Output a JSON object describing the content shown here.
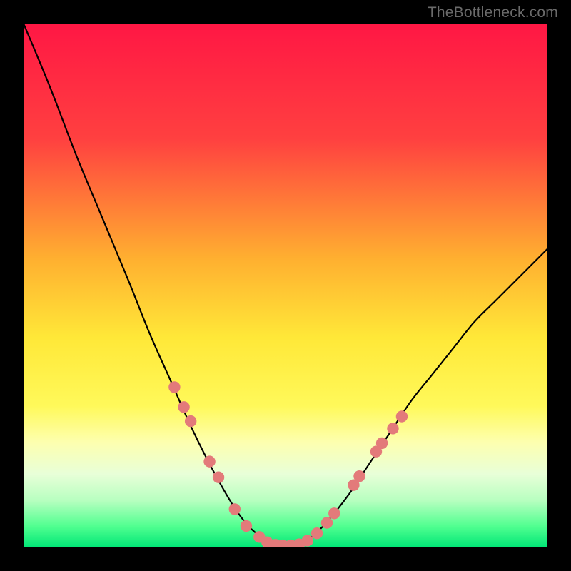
{
  "watermark": "TheBottleneck.com",
  "chart_data": {
    "type": "line",
    "title": "",
    "xlabel": "",
    "ylabel": "",
    "xlim": [
      0,
      100
    ],
    "ylim": [
      0,
      100
    ],
    "gradient_stops": [
      {
        "offset": 0,
        "color": "#ff1744"
      },
      {
        "offset": 22,
        "color": "#ff4040"
      },
      {
        "offset": 45,
        "color": "#ffb030"
      },
      {
        "offset": 60,
        "color": "#ffe838"
      },
      {
        "offset": 73,
        "color": "#fff95a"
      },
      {
        "offset": 80,
        "color": "#fdffb0"
      },
      {
        "offset": 86,
        "color": "#e8ffd8"
      },
      {
        "offset": 91,
        "color": "#b8ffc0"
      },
      {
        "offset": 96,
        "color": "#50ff90"
      },
      {
        "offset": 100,
        "color": "#00e676"
      }
    ],
    "series": [
      {
        "name": "bottleneck-curve",
        "x": [
          0,
          5,
          10,
          15,
          20,
          24,
          28,
          32,
          36,
          40,
          43,
          46,
          48,
          50,
          52,
          55,
          58,
          62,
          66,
          70,
          74,
          78,
          82,
          86,
          90,
          94,
          98,
          100
        ],
        "y": [
          100,
          88,
          75,
          63,
          51,
          41,
          32,
          23,
          15,
          8,
          4,
          1.5,
          0.5,
          0.3,
          0.5,
          2,
          5,
          10,
          16,
          22,
          28,
          33,
          38,
          43,
          47,
          51,
          55,
          57
        ]
      }
    ],
    "markers": {
      "name": "highlighted-points",
      "color": "#e37a7a",
      "points": [
        {
          "x": 28.8,
          "y": 30.6
        },
        {
          "x": 30.6,
          "y": 26.8
        },
        {
          "x": 31.9,
          "y": 24.1
        },
        {
          "x": 35.5,
          "y": 16.4
        },
        {
          "x": 37.2,
          "y": 13.4
        },
        {
          "x": 40.3,
          "y": 7.3
        },
        {
          "x": 42.5,
          "y": 4.1
        },
        {
          "x": 45.0,
          "y": 2.0
        },
        {
          "x": 46.5,
          "y": 1.0
        },
        {
          "x": 48.1,
          "y": 0.5
        },
        {
          "x": 49.5,
          "y": 0.4
        },
        {
          "x": 51.0,
          "y": 0.4
        },
        {
          "x": 52.6,
          "y": 0.6
        },
        {
          "x": 54.2,
          "y": 1.3
        },
        {
          "x": 56.0,
          "y": 2.7
        },
        {
          "x": 57.9,
          "y": 4.7
        },
        {
          "x": 59.3,
          "y": 6.5
        },
        {
          "x": 63.0,
          "y": 11.9
        },
        {
          "x": 64.1,
          "y": 13.6
        },
        {
          "x": 67.3,
          "y": 18.3
        },
        {
          "x": 68.4,
          "y": 19.9
        },
        {
          "x": 70.5,
          "y": 22.7
        },
        {
          "x": 72.2,
          "y": 25.0
        }
      ]
    }
  }
}
